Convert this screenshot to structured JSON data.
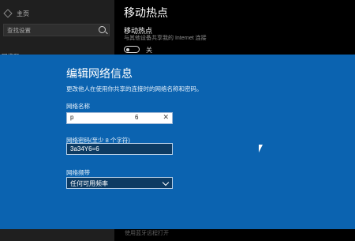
{
  "sidebar": {
    "home_label": "主页",
    "search_placeholder": "查找设置",
    "section_label": "网络和 Internet"
  },
  "main": {
    "page_title": "移动热点",
    "section_title": "移动热点",
    "description": "与其他设备共享我的 Internet 连接",
    "toggle_state": "关",
    "bottom_hint": "使用蓝牙远程打开"
  },
  "dialog": {
    "title": "编辑网络信息",
    "subtitle": "更改他人在使用你共享的连接时的网络名称和密码。",
    "name_label": "网络名称",
    "name_value_left": "p",
    "name_value_right": "6",
    "clear_symbol": "✕",
    "password_label": "网络密码(至少 8 个字符)",
    "password_value": "3a34Y6=6",
    "band_label": "网络频带",
    "band_value": "任何可用频率"
  }
}
